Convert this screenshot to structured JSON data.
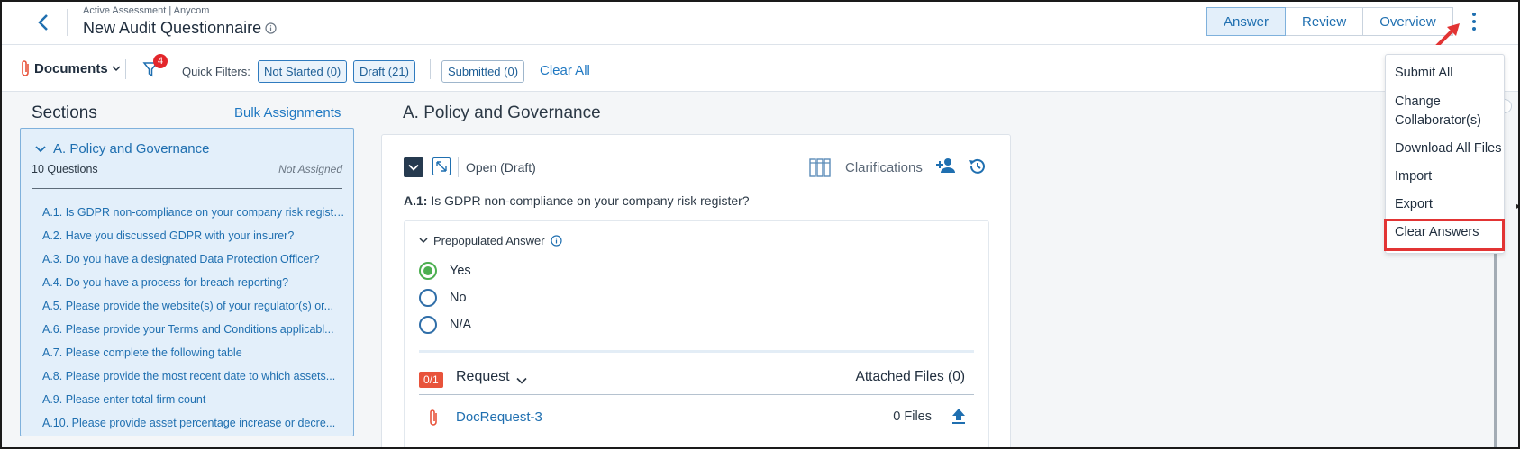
{
  "header": {
    "breadcrumb": "Active Assessment | Anycom",
    "title": "New Audit Questionnaire",
    "tabs": [
      {
        "label": "Answer",
        "active": true
      },
      {
        "label": "Review",
        "active": false
      },
      {
        "label": "Overview",
        "active": false
      }
    ]
  },
  "toolbar": {
    "documents_label": "Documents",
    "filter_count": "4",
    "quick_filters_label": "Quick Filters:",
    "chips": {
      "not_started": "Not Started (0)",
      "draft": "Draft (21)",
      "submitted": "Submitted (0)"
    },
    "clear_all": "Clear All"
  },
  "sections": {
    "title": "Sections",
    "bulk_assignments": "Bulk Assignments",
    "current": {
      "name": "A. Policy and Governance",
      "count": "10 Questions",
      "assignment": "Not Assigned",
      "questions": [
        "A.1. Is GDPR non-compliance on your company risk register?",
        "A.2. Have you discussed GDPR with your insurer?",
        "A.3. Do you have a designated Data Protection Officer?",
        "A.4. Do you have a process for breach reporting?",
        "A.5. Please provide the website(s) of your regulator(s) or...",
        "A.6. Please provide your Terms and Conditions applicabl...",
        "A.7. Please complete the following table",
        "A.8. Please provide the most recent date to which assets...",
        "A.9. Please enter total firm count",
        "A.10. Please provide asset percentage increase or decre..."
      ]
    }
  },
  "main": {
    "title": "A. Policy and Governance",
    "question": {
      "status": "Open (Draft)",
      "clarifications": "Clarifications",
      "number": "A.1:",
      "text": "Is GDPR non-compliance on your company risk register?",
      "prepopulated_label": "Prepopulated Answer",
      "options": [
        "Yes",
        "No",
        "N/A"
      ],
      "selected": "Yes",
      "request": {
        "badge": "0/1",
        "label": "Request",
        "attached": "Attached Files (0)",
        "doc_name": "DocRequest-3",
        "files": "0 Files"
      }
    }
  },
  "menu": {
    "items": [
      "Submit All",
      "Change Collaborator(s)",
      "Download All Files",
      "Import",
      "Export",
      "Clear Answers"
    ],
    "highlighted": "Clear Answers"
  },
  "colors": {
    "accent": "#1f6fb0",
    "highlight": "#e23434",
    "badge": "#e3262b",
    "request_badge": "#e8533b",
    "selected_radio": "#4caf50"
  }
}
